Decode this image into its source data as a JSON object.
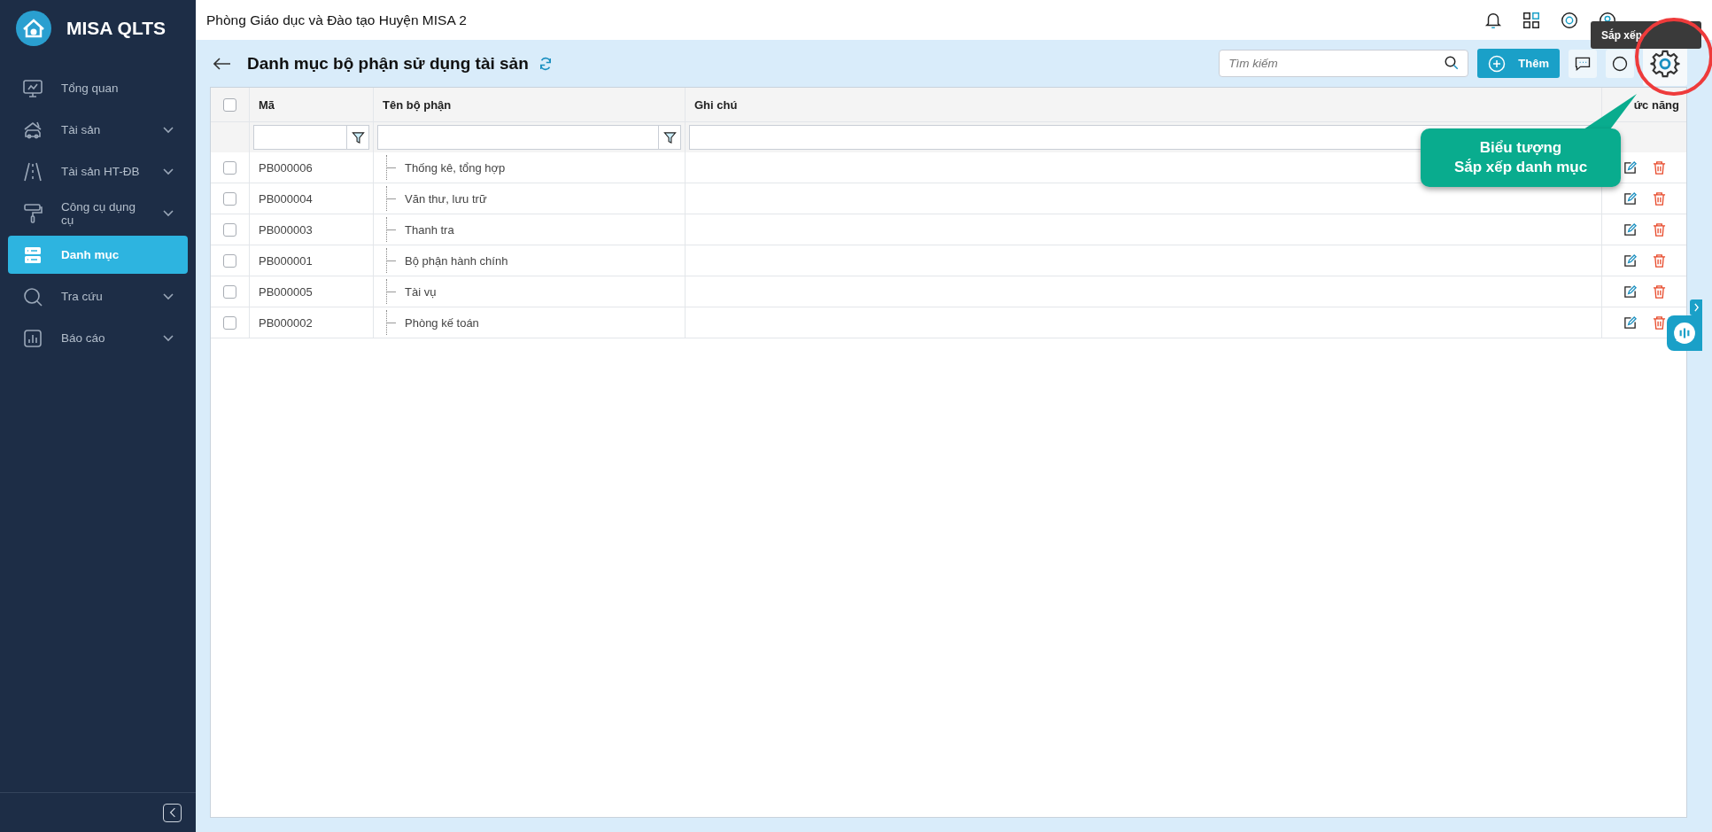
{
  "app": {
    "name": "MISA QLTS"
  },
  "sidebar": {
    "items": [
      {
        "kind": "overview",
        "label": "Tổng quan",
        "expandable": false,
        "selected": false
      },
      {
        "kind": "assets",
        "label": "Tài sản",
        "expandable": true,
        "selected": false
      },
      {
        "kind": "road",
        "label": "Tài sản HT-ĐB",
        "expandable": true,
        "selected": false
      },
      {
        "kind": "tools",
        "label": "Công cụ dụng cụ",
        "expandable": true,
        "selected": false
      },
      {
        "kind": "catalog",
        "label": "Danh mục",
        "expandable": false,
        "selected": true
      },
      {
        "kind": "lookup",
        "label": "Tra cứu",
        "expandable": true,
        "selected": false
      },
      {
        "kind": "report",
        "label": "Báo cáo",
        "expandable": true,
        "selected": false
      }
    ]
  },
  "header": {
    "organization": "Phòng Giáo dục và Đào tạo Huyện MISA 2"
  },
  "page": {
    "title": "Danh mục bộ phận sử dụng tài sản",
    "search": {
      "placeholder": "Tìm kiếm"
    },
    "add_button": "Thêm"
  },
  "tooltip": "Sắp xếp",
  "callout": {
    "lines": [
      "Biểu tượng",
      "Sắp xếp danh mục"
    ]
  },
  "table": {
    "all_checked": false,
    "columns": [
      "Mã",
      "Tên bộ phận",
      "Ghi chú",
      "ức năng"
    ],
    "rows": [
      {
        "code": "PB000006",
        "name": "Thống kê, tổng hợp",
        "checked": false
      },
      {
        "code": "PB000004",
        "name": "Văn thư, lưu trữ",
        "checked": false
      },
      {
        "code": "PB000003",
        "name": "Thanh tra",
        "checked": false
      },
      {
        "code": "PB000001",
        "name": "Bộ phận hành chính",
        "checked": false
      },
      {
        "code": "PB000005",
        "name": "Tài vụ",
        "checked": false
      },
      {
        "code": "PB000002",
        "name": "Phòng kế toán",
        "checked": false
      }
    ]
  }
}
